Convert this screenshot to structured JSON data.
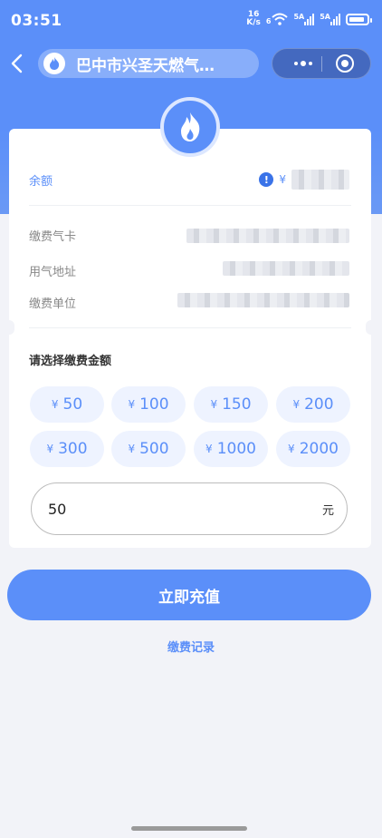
{
  "status_bar": {
    "time": "03:51",
    "net_speed_value": "16",
    "net_speed_unit": "K/s",
    "wifi_badge": "6",
    "sim1_badge": "5A",
    "sim2_badge": "5A",
    "battery_level": 0.74
  },
  "nav": {
    "title": "巴中市兴圣天燃气…"
  },
  "balance": {
    "label": "余额",
    "currency": "¥"
  },
  "info": {
    "card_label": "缴费气卡",
    "address_label": "用气地址",
    "unit_label": "缴费单位"
  },
  "amounts": {
    "title": "请选择缴费金额",
    "currency": "¥",
    "options": [
      "50",
      "100",
      "150",
      "200",
      "300",
      "500",
      "1000",
      "2000"
    ]
  },
  "custom": {
    "value": "50",
    "unit": "元"
  },
  "actions": {
    "pay_label": "立即充值",
    "history_label": "缴费记录"
  },
  "colors": {
    "accent": "#5b8ff9",
    "chip_bg": "#eef3ff",
    "page_bg": "#f2f3f8"
  }
}
